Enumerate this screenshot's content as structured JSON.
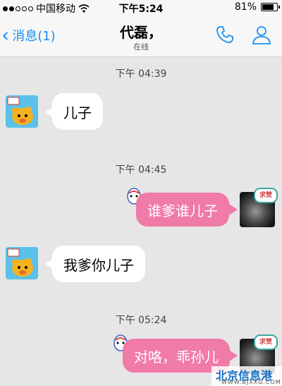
{
  "status_bar": {
    "carrier": "中国移动",
    "time": "下午5:24",
    "battery": "81%"
  },
  "nav": {
    "back_label": "消息(1)",
    "title": "代磊，",
    "subtitle": "在线"
  },
  "messages": [
    {
      "timestamp": "下午 04:39",
      "side": "left",
      "text": "儿子"
    },
    {
      "timestamp": "下午 04:45",
      "side": "right",
      "text": "谁爹谁儿子"
    },
    {
      "timestamp": "",
      "side": "left",
      "text": "我爹你儿子"
    },
    {
      "timestamp": "下午 05:24",
      "side": "right",
      "text": "对咯，乖孙儿"
    }
  ],
  "user_avatar_badge": "求赞",
  "watermark": {
    "name": "北京信息港",
    "url": "WWW.BJXXG.COM"
  },
  "colors": {
    "accent": "#1a8ef2",
    "bubble_right": "#f07aa8",
    "bubble_left": "#ffffff",
    "background": "#e6e6e6"
  }
}
